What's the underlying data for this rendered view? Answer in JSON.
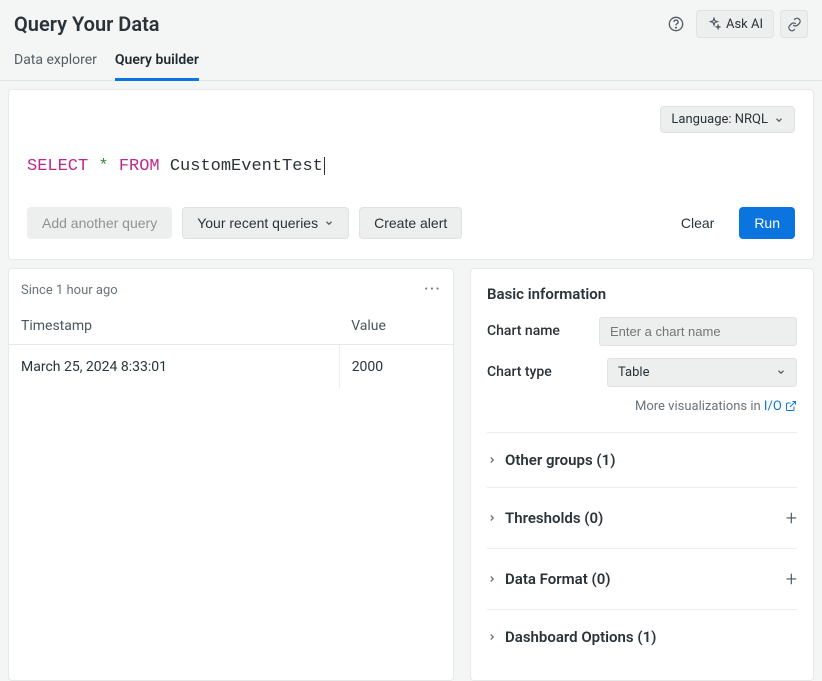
{
  "header": {
    "title": "Query Your Data",
    "ask_ai_label": "Ask AI"
  },
  "tabs": {
    "data_explorer": "Data explorer",
    "query_builder": "Query builder"
  },
  "query": {
    "language_label": "Language: NRQL",
    "select": "SELECT",
    "star": "*",
    "from": "FROM",
    "identifier": "CustomEventTest"
  },
  "actions": {
    "add_another": "Add another query",
    "recent": "Your recent queries",
    "create_alert": "Create alert",
    "clear": "Clear",
    "run": "Run"
  },
  "results": {
    "since": "Since 1 hour ago",
    "col_timestamp": "Timestamp",
    "col_value": "Value",
    "rows": [
      {
        "timestamp": "March 25, 2024 8:33:01",
        "value": "2000"
      }
    ]
  },
  "panel": {
    "basic_info": "Basic information",
    "chart_name_label": "Chart name",
    "chart_name_placeholder": "Enter a chart name",
    "chart_type_label": "Chart type",
    "chart_type_value": "Table",
    "more_viz_text": "More visualizations in ",
    "more_viz_link": "I/O",
    "accordion": {
      "other_groups": "Other groups (1)",
      "thresholds": "Thresholds (0)",
      "data_format": "Data Format (0)",
      "dashboard_options": "Dashboard Options (1)"
    }
  }
}
